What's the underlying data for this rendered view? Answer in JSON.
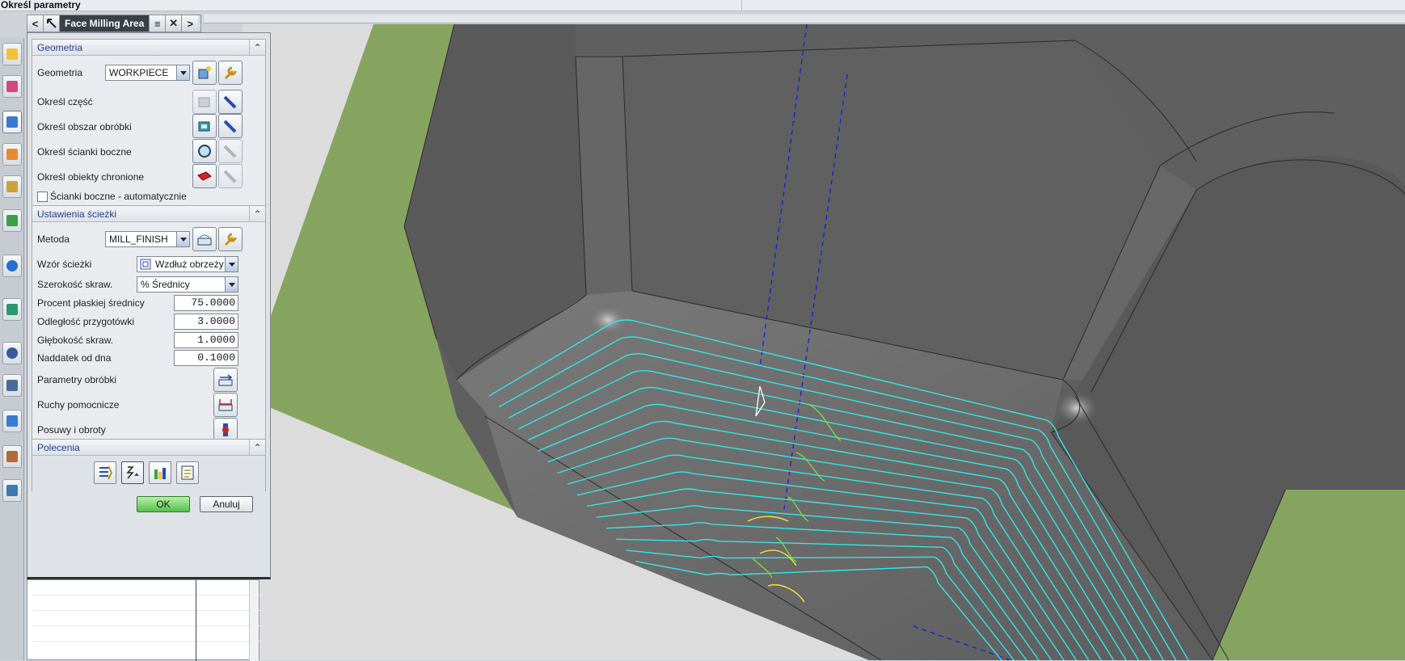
{
  "window": {
    "title": "Określ parametry"
  },
  "panel": {
    "title": "Face Milling Area",
    "back": "<",
    "forward": ">",
    "close": "✕",
    "menu": "≡"
  },
  "geometry_section": {
    "header": "Geometria",
    "geometry_label": "Geometria",
    "geometry_value": "WORKPIECE",
    "part_label": "Określ część",
    "cut_area_label": "Określ obszar obróbki",
    "walls_label": "Określ ścianki boczne",
    "check_label": "Określ obiekty chronione",
    "auto_walls_label": "Ścianki boczne - automatycznie"
  },
  "path_section": {
    "header": "Ustawienia ścieżki",
    "method_label": "Metoda",
    "method_value": "MILL_FINISH",
    "pattern_label": "Wzór ścieżki",
    "pattern_value": "Wzdłuż obrzeży",
    "stepover_label": "Szerokość skraw.",
    "stepover_value": "% Średnicy",
    "flat_dia_label": "Procent płaskiej średnicy",
    "flat_dia_value": "75.0000",
    "blank_dist_label": "Odległość przygotówki",
    "blank_dist_value": "3.0000",
    "depth_label": "Głębokość skraw.",
    "depth_value": "1.0000",
    "floor_stock_label": "Naddatek od dna",
    "floor_stock_value": "0.1000",
    "cutting_params_label": "Parametry obróbki",
    "non_cutting_label": "Ruchy pomocnicze",
    "feeds_label": "Posuwy i obroty"
  },
  "commands_section": {
    "header": "Polecenia"
  },
  "footer": {
    "ok": "OK",
    "cancel": "Anuluj"
  },
  "colors": {
    "toolpath": "#33e6e6",
    "engage": "#7adf3a",
    "retract": "#ffe033",
    "model_face": "#6f6f6f",
    "blank_green": "#86a460",
    "axis": "#1a1ae0"
  },
  "icons": [
    "new-geometry-icon",
    "edit-wrench-icon",
    "part-geometry-icon",
    "flashlight-icon",
    "cut-area-icon",
    "wall-geometry-icon",
    "check-geometry-icon",
    "method-icon",
    "cutting-params-icon",
    "non-cutting-icon",
    "feeds-speeds-icon",
    "generate-icon",
    "replay-icon",
    "verify-icon",
    "list-icon"
  ]
}
